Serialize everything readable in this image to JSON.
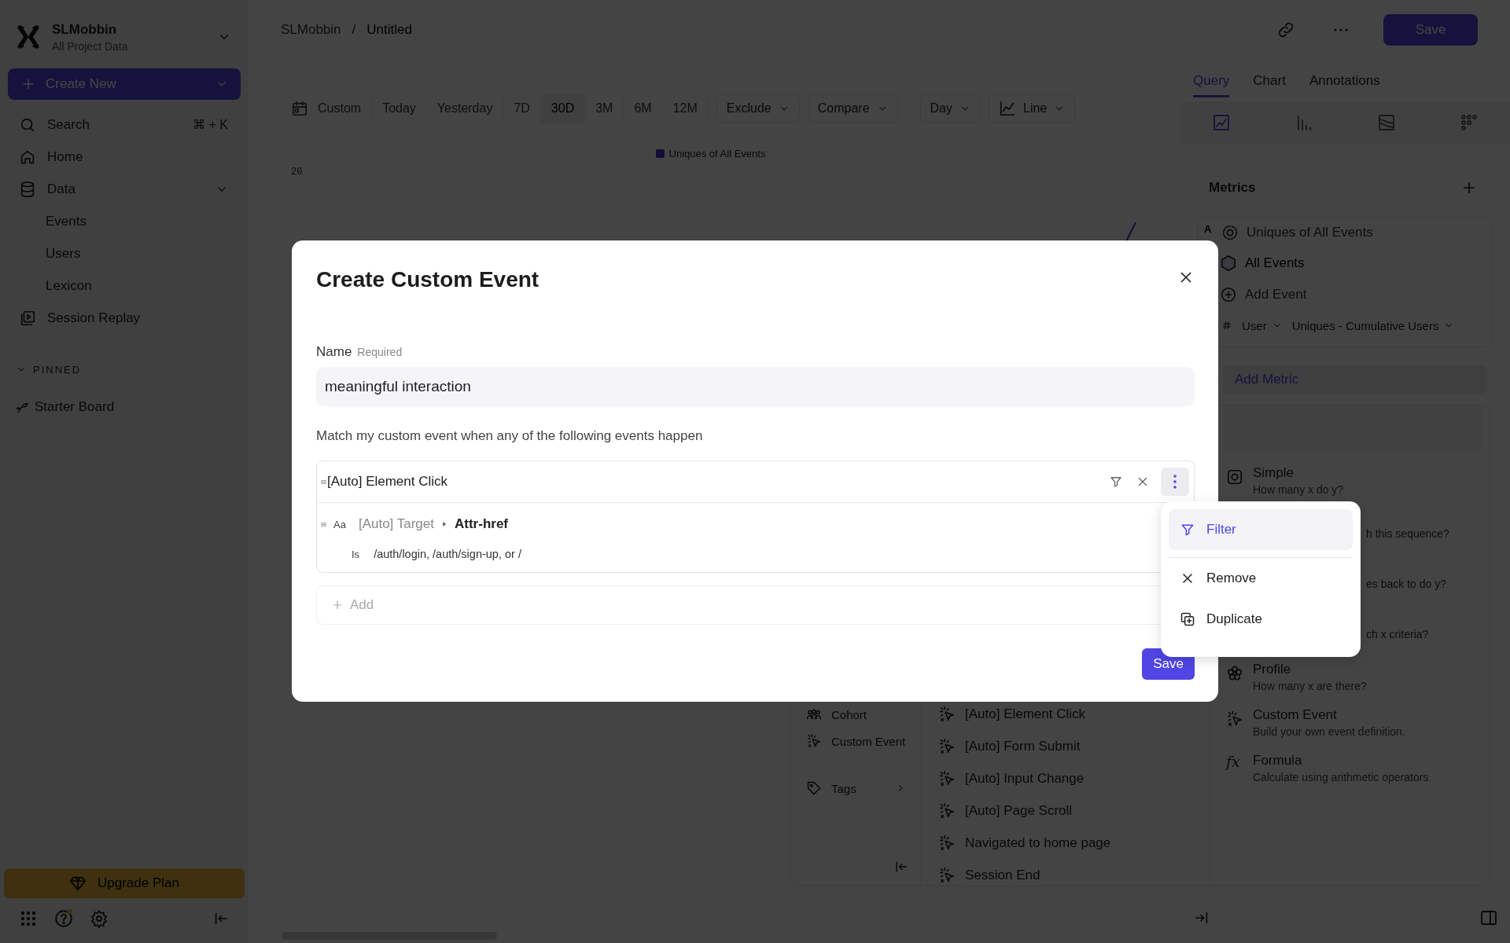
{
  "sidebar": {
    "workspace": {
      "name": "SLMobbin",
      "subtitle": "All Project Data"
    },
    "create_button": "Create New",
    "search": {
      "label": "Search",
      "shortcut": "⌘ + K"
    },
    "nav": [
      {
        "label": "Home"
      },
      {
        "label": "Data",
        "expanded": true,
        "children": [
          {
            "label": "Events"
          },
          {
            "label": "Users"
          },
          {
            "label": "Lexicon"
          }
        ]
      },
      {
        "label": "Session Replay"
      }
    ],
    "pinned": {
      "heading": "PINNED",
      "expanded": true,
      "items": [
        {
          "label": "Starter Board"
        }
      ]
    },
    "upgrade_button": "Upgrade Plan"
  },
  "header": {
    "breadcrumb": [
      "SLMobbin",
      "Untitled"
    ],
    "separator": "/",
    "save_button": "Save"
  },
  "toolbar": {
    "ranges": [
      {
        "label": "Custom",
        "selected": false
      },
      {
        "label": "Today",
        "selected": false
      },
      {
        "label": "Yesterday",
        "selected": false
      },
      {
        "label": "7D",
        "selected": false
      },
      {
        "label": "30D",
        "selected": true
      },
      {
        "label": "3M",
        "selected": false
      },
      {
        "label": "6M",
        "selected": false
      },
      {
        "label": "12M",
        "selected": false
      }
    ],
    "dropdowns": [
      "Exclude",
      "Compare",
      "Day",
      "Line"
    ]
  },
  "chart": {
    "legend": "Uniques of All Events",
    "y_tick": "20"
  },
  "right_panel": {
    "tabs": [
      {
        "label": "Query",
        "selected": true
      },
      {
        "label": "Chart",
        "selected": false
      },
      {
        "label": "Annotations",
        "selected": false
      }
    ],
    "chart_types": [
      {
        "selected": true
      },
      {
        "selected": false
      },
      {
        "selected": false
      },
      {
        "selected": false
      }
    ],
    "metrics_heading": "Metrics",
    "metrics": [
      {
        "letter": "A",
        "title": "Uniques of All Events",
        "events": [
          "All Events"
        ],
        "add_event": "Add Event",
        "breakdown": [
          "User",
          "Uniques - Cumulative Users"
        ]
      }
    ],
    "add_metric": "Add Metric"
  },
  "metric_picker": {
    "categories": [
      {
        "label": "Cohort",
        "submenu": false
      },
      {
        "label": "Custom Event",
        "submenu": false
      },
      {
        "label": "Tags",
        "submenu": true
      }
    ],
    "events": [
      "[Auto] Element Click",
      "[Auto] Form Submit",
      "[Auto] Input Change",
      "[Auto] Page Scroll",
      "Navigated to home page",
      "Session End"
    ],
    "types": [
      {
        "kind": "full",
        "title": "Simple",
        "description": "How many x do y?"
      },
      {
        "kind": "partial",
        "description": "h this sequence?"
      },
      {
        "kind": "partial",
        "description": "es back to do y?"
      },
      {
        "kind": "partial",
        "description": "ch x criteria?"
      },
      {
        "kind": "full",
        "title": "Profile",
        "description": "How many x are there?"
      },
      {
        "kind": "full",
        "title": "Custom Event",
        "description": "Build your own event definition."
      },
      {
        "kind": "full",
        "title": "Formula",
        "description": "Calculate using arithmetic operators.",
        "icon_text": "fx"
      }
    ]
  },
  "modal": {
    "title": "Create Custom Event",
    "name_label": "Name",
    "required_label": "Required",
    "name_value": "meaningful interaction",
    "description": "Match my custom event when any of the following events happen",
    "events": [
      {
        "name": "[Auto] Element Click",
        "menu_open": true,
        "filters": [
          {
            "type_label": "Aa",
            "property_group": "[Auto] Target",
            "property": "Attr-href",
            "operator": "Is",
            "value": "/auth/login, /auth/sign-up, or /"
          }
        ]
      }
    ],
    "add_label": "Add",
    "save_button": "Save"
  },
  "event_menu": {
    "items": [
      {
        "label": "Filter",
        "selected": true,
        "divider_after": true
      },
      {
        "label": "Remove",
        "selected": false,
        "divider_after": false
      },
      {
        "label": "Duplicate",
        "selected": false,
        "divider_after": false
      }
    ]
  }
}
